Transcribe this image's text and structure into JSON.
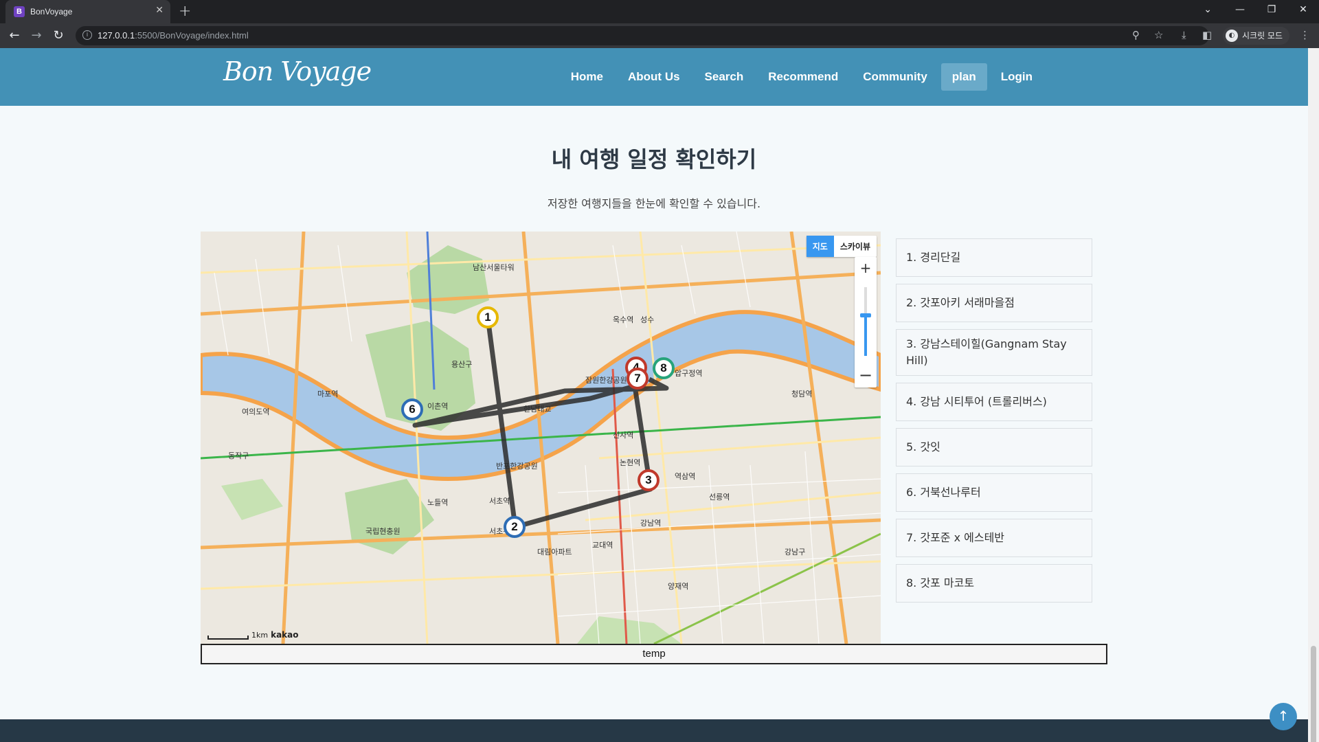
{
  "browser": {
    "tab_title": "BonVoyage",
    "tab_favicon": "B",
    "url_host": "127.0.0.1",
    "url_rest": ":5500/BonVoyage/index.html",
    "incognito_label": "시크릿 모드"
  },
  "site": {
    "logo": "Bon Voyage",
    "nav": [
      "Home",
      "About Us",
      "Search",
      "Recommend",
      "Community",
      "plan",
      "Login"
    ],
    "active_nav": "plan"
  },
  "page": {
    "title": "내 여행 일정 확인하기",
    "subtitle": "저장한 여행지들을 한눈에 확인할 수 있습니다."
  },
  "map": {
    "type_map": "지도",
    "type_sky": "스카이뷰",
    "zoom_in": "+",
    "zoom_out": "−",
    "scale_label": "1km",
    "provider": "kakao",
    "labels": [
      "용산구",
      "서초구",
      "강남구",
      "동작구",
      "반포한강공원",
      "잠원한강공원",
      "이촌역",
      "노들역",
      "신사역",
      "논현역",
      "강남역",
      "교대역",
      "서초역",
      "여의도역",
      "마포역",
      "한남대교",
      "성수",
      "옥수역",
      "압구정역",
      "청담역",
      "선릉역",
      "역삼역",
      "양재역",
      "대림아파트",
      "국립현충원",
      "남산서울타워"
    ],
    "markers": [
      {
        "n": "1",
        "color": "#e6b800"
      },
      {
        "n": "2",
        "color": "#2e6db5"
      },
      {
        "n": "3",
        "color": "#c0392b"
      },
      {
        "n": "4",
        "color": "#c0392b"
      },
      {
        "n": "6",
        "color": "#2e6db5"
      },
      {
        "n": "7",
        "color": "#c0392b"
      },
      {
        "n": "8",
        "color": "#27a37a"
      }
    ]
  },
  "plan_list": [
    "1. 경리단길",
    "2. 갓포아키 서래마을점",
    "3. 강남스테이힐(Gangnam Stay Hill)",
    "4. 강남 시티투어 (트롤리버스)",
    "5. 갓잇",
    "6. 거북선나루터",
    "7. 갓포준 x 에스테반",
    "8. 갓포 마코토"
  ],
  "temp_label": "temp",
  "scroll_top_icon": "arrow-up-icon"
}
